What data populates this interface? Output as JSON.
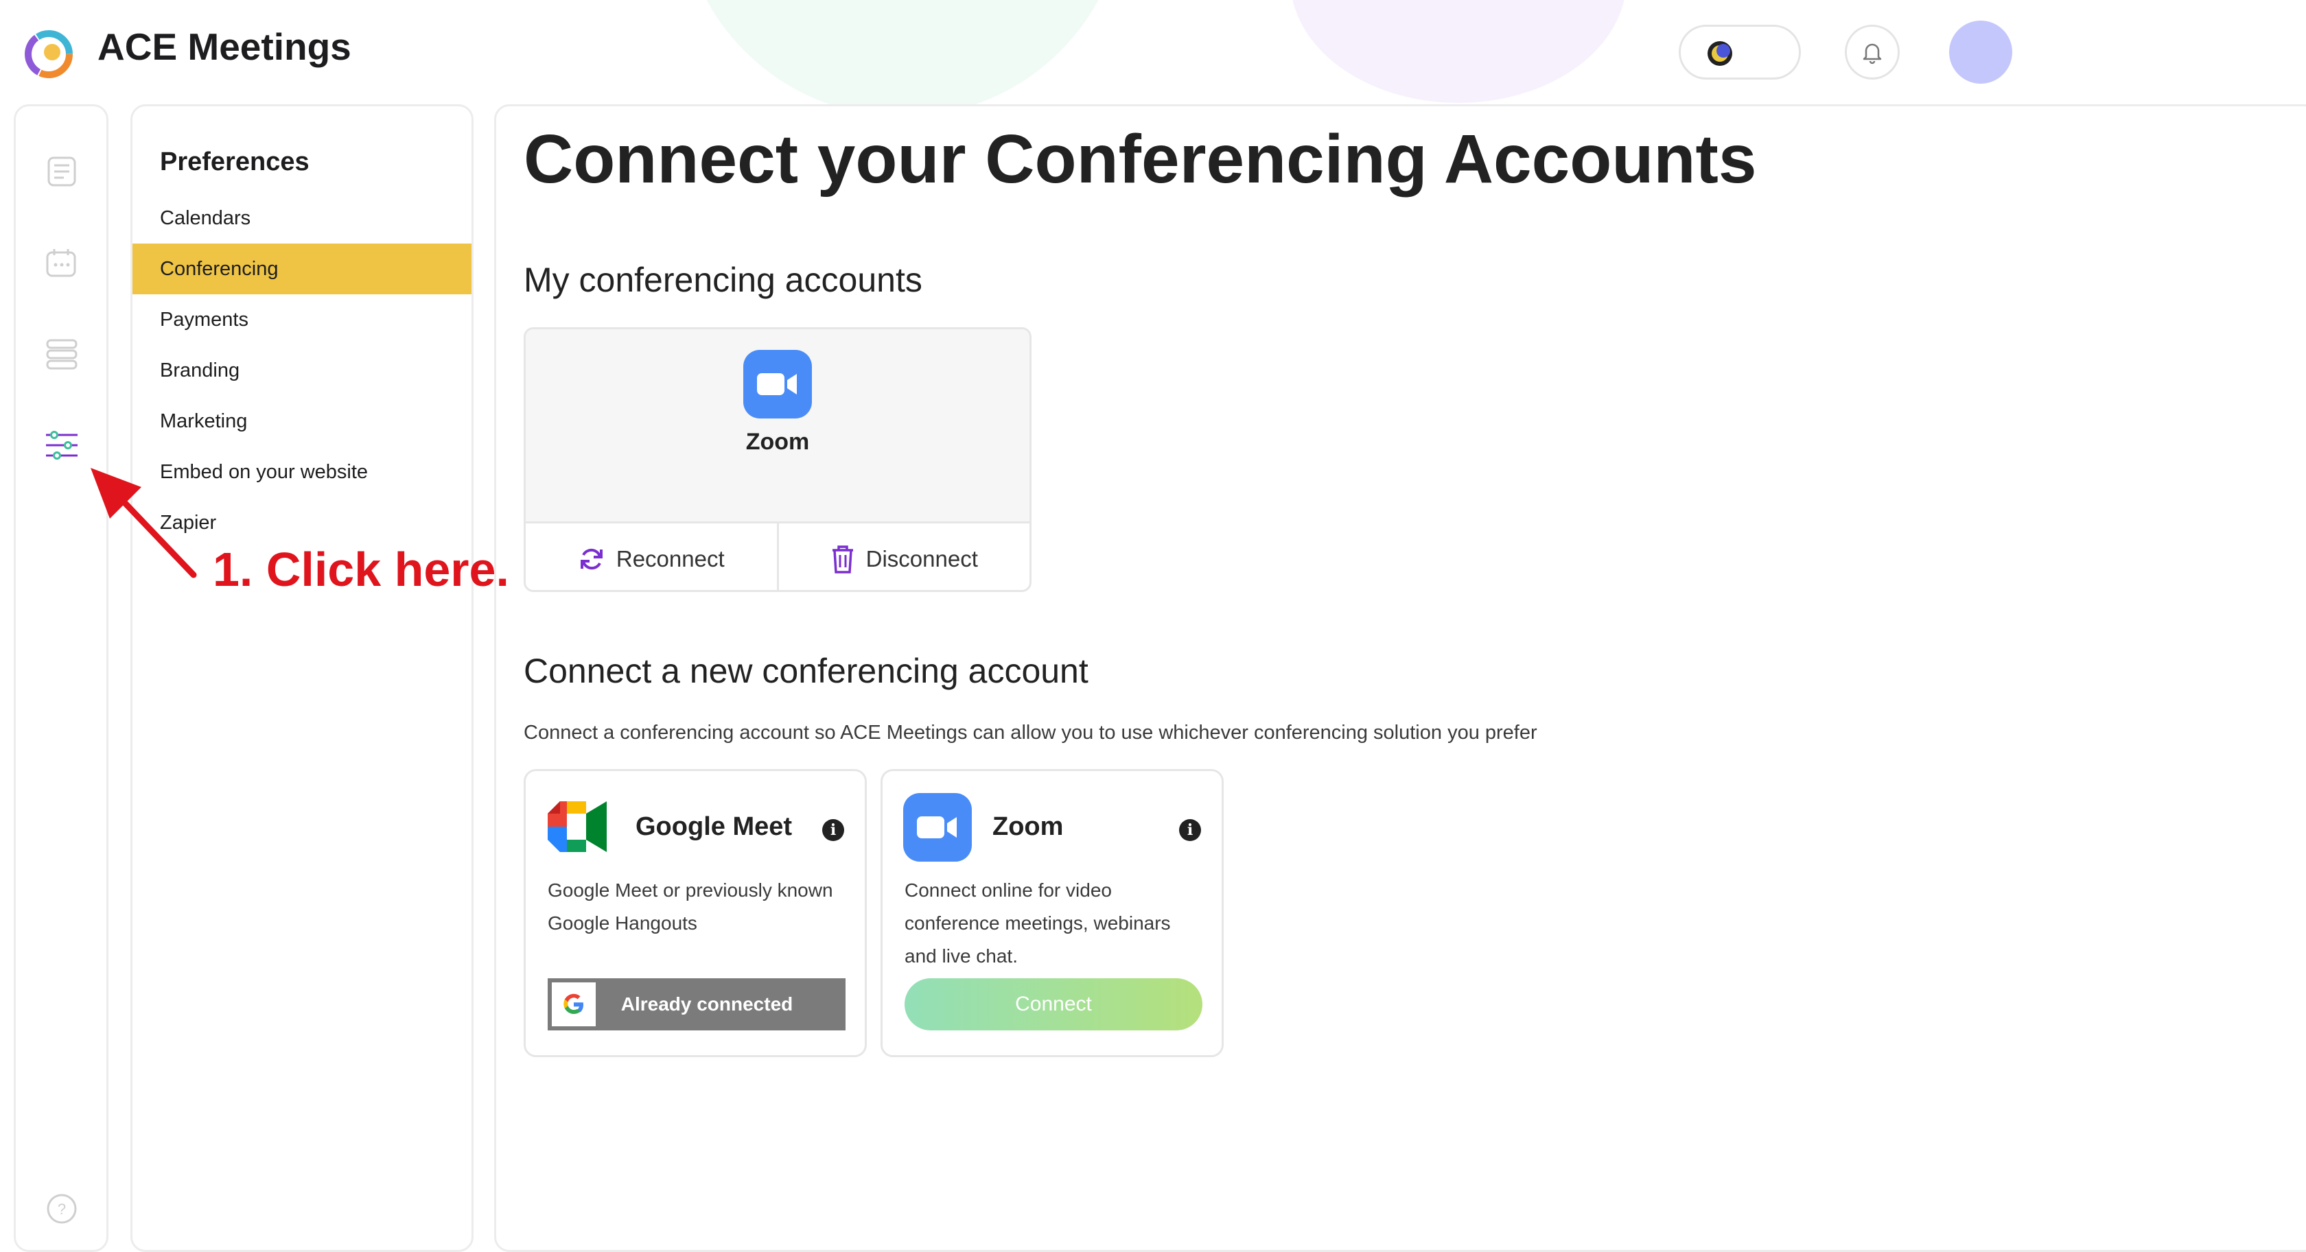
{
  "header": {
    "app_title": "ACE Meetings"
  },
  "rail": {
    "items": [
      {
        "icon": "document-list-icon"
      },
      {
        "icon": "calendar-chat-icon"
      },
      {
        "icon": "stacked-list-icon"
      },
      {
        "icon": "sliders-icon",
        "active": true
      },
      {
        "icon": "help-icon"
      }
    ]
  },
  "preferences": {
    "title": "Preferences",
    "items": [
      {
        "label": "Calendars"
      },
      {
        "label": "Conferencing",
        "active": true
      },
      {
        "label": "Payments"
      },
      {
        "label": "Branding"
      },
      {
        "label": "Marketing"
      },
      {
        "label": "Embed on your website"
      },
      {
        "label": "Zapier"
      }
    ]
  },
  "main": {
    "page_title": "Connect your Conferencing Accounts",
    "my_accounts": {
      "title": "My conferencing accounts",
      "account_name": "Zoom",
      "reconnect_label": "Reconnect",
      "disconnect_label": "Disconnect"
    },
    "new_account": {
      "title": "Connect a new conferencing account",
      "description": "Connect a conferencing account so ACE Meetings can allow you to use whichever conferencing solution you prefer",
      "providers": [
        {
          "name": "Google Meet",
          "description": "Google Meet or previously known Google Hangouts",
          "button_label": "Already connected"
        },
        {
          "name": "Zoom",
          "description": "Connect online for video conference meetings, webinars and live chat.",
          "button_label": "Connect"
        }
      ]
    }
  },
  "annotation": {
    "text": "1. Click here."
  },
  "colors": {
    "active_item": "#efc444",
    "zoom_blue": "#4a8cf7",
    "accent_purple": "#7b2fd0",
    "annotation_red": "#e0141c",
    "avatar": "#c4c7fb"
  }
}
